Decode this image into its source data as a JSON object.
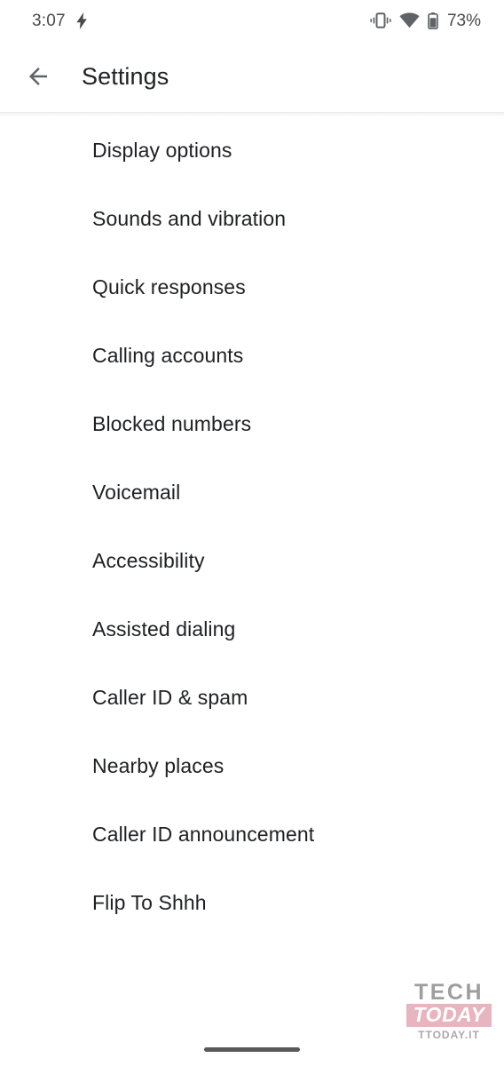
{
  "status_bar": {
    "time": "3:07",
    "charging_icon": "lightning-bolt-icon",
    "vibrate_icon": "vibrate-icon",
    "wifi_icon": "wifi-icon",
    "battery_icon": "battery-icon",
    "battery_percent": "73%"
  },
  "app_bar": {
    "back_icon": "arrow-left-icon",
    "title": "Settings"
  },
  "settings_list": {
    "items": [
      {
        "label": "Display options"
      },
      {
        "label": "Sounds and vibration"
      },
      {
        "label": "Quick responses"
      },
      {
        "label": "Calling accounts"
      },
      {
        "label": "Blocked numbers"
      },
      {
        "label": "Voicemail"
      },
      {
        "label": "Accessibility"
      },
      {
        "label": "Assisted dialing"
      },
      {
        "label": "Caller ID & spam"
      },
      {
        "label": "Nearby places"
      },
      {
        "label": "Caller ID announcement"
      },
      {
        "label": "Flip To Shhh"
      }
    ]
  },
  "watermark": {
    "line1": "TECH",
    "line2": "TODAY",
    "line3": "TTODAY.IT",
    "tech_color": "#8e8e8e",
    "today_bg_color": "#e3a8b4",
    "today_text_color": "#ffffff"
  },
  "nav_bar": {
    "home_indicator": "home-indicator"
  },
  "colors": {
    "background": "#ffffff",
    "primary_text": "#202124",
    "status_text": "#4a4a4a",
    "divider": "#e8eaed"
  }
}
